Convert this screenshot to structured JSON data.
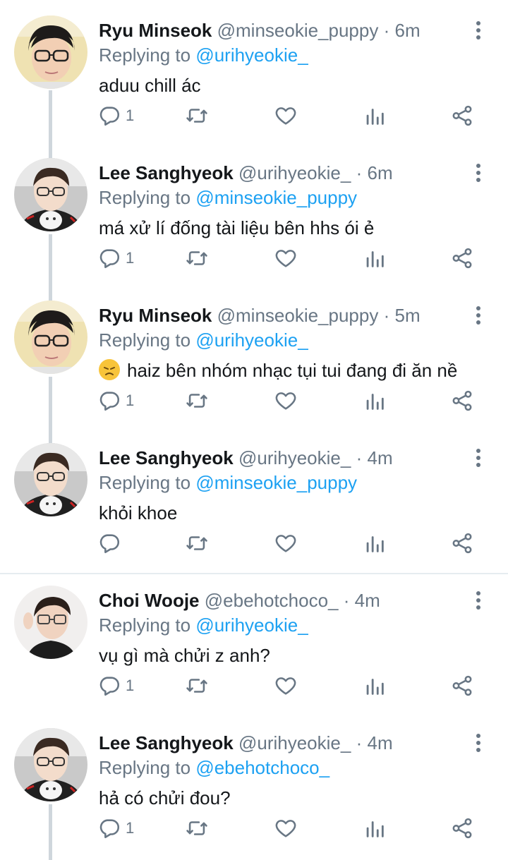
{
  "tweets": [
    {
      "name": "Ryu Minseok",
      "handle": "@minseokie_puppy",
      "time": "6m",
      "replying_label": "Replying to",
      "replying_to": "@urihyeokie_",
      "text": "aduu chill ác",
      "emoji": "",
      "reply_count": "1",
      "avatar": "avatar-ryu"
    },
    {
      "name": "Lee Sanghyeok",
      "handle": "@urihyeokie_",
      "time": "6m",
      "replying_label": "Replying to",
      "replying_to": "@minseokie_puppy",
      "text": "má xử lí đống tài liệu bên hhs ói ẻ",
      "emoji": "",
      "reply_count": "1",
      "avatar": "avatar-lee"
    },
    {
      "name": "Ryu Minseok",
      "handle": "@minseokie_puppy",
      "time": "5m",
      "replying_label": "Replying to",
      "replying_to": "@urihyeokie_",
      "text": "haiz bên nhóm nhạc tụi tui đang đi ăn nề",
      "emoji": "disappointed-face",
      "reply_count": "1",
      "avatar": "avatar-ryu"
    },
    {
      "name": "Lee Sanghyeok",
      "handle": "@urihyeokie_",
      "time": "4m",
      "replying_label": "Replying to",
      "replying_to": "@minseokie_puppy",
      "text": "khỏi khoe",
      "emoji": "",
      "reply_count": "",
      "avatar": "avatar-lee"
    },
    {
      "name": "Choi Wooje",
      "handle": "@ebehotchoco_",
      "time": "4m",
      "replying_label": "Replying to",
      "replying_to": "@urihyeokie_",
      "text": "vụ gì mà chửi z anh?",
      "emoji": "",
      "reply_count": "1",
      "avatar": "avatar-choi"
    },
    {
      "name": "Lee Sanghyeok",
      "handle": "@urihyeokie_",
      "time": "4m",
      "replying_label": "Replying to",
      "replying_to": "@ebehotchoco_",
      "text": "hả có chửi đou?",
      "emoji": "",
      "reply_count": "1",
      "avatar": "avatar-lee"
    }
  ],
  "separator": "·",
  "colors": {
    "mention": "#1da1f2",
    "secondary": "#687684",
    "thread_line": "#cfd6dc"
  },
  "icons": [
    "reply-icon",
    "retweet-icon",
    "like-icon",
    "analytics-icon",
    "share-icon",
    "more-options-icon"
  ]
}
